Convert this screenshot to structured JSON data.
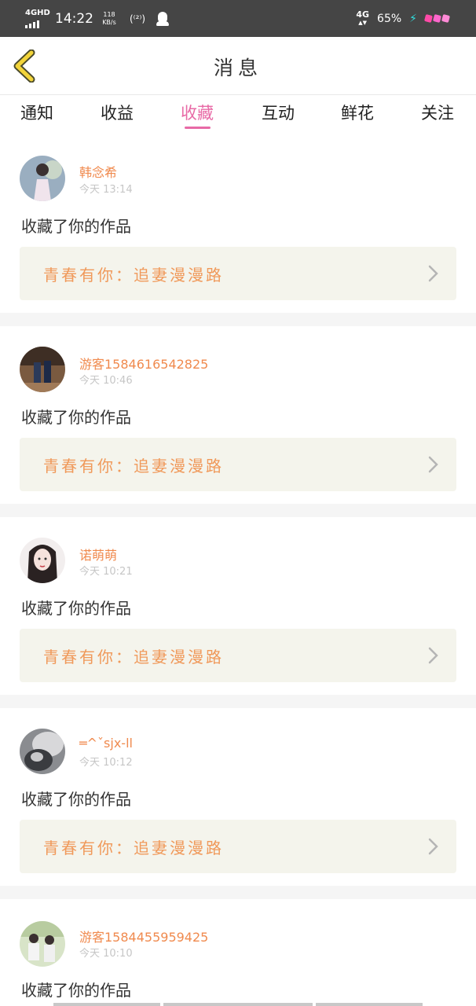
{
  "status_bar": {
    "network_type": "4GHD",
    "time": "14:22",
    "speed_value": "118",
    "speed_unit": "KB/s",
    "hotspot": "(⁽²⁾)",
    "cellular": "4G",
    "battery": "65%",
    "charging": "⚡"
  },
  "header": {
    "title": "消息"
  },
  "tabs": [
    {
      "label": "通知"
    },
    {
      "label": "收益"
    },
    {
      "label": "收藏"
    },
    {
      "label": "互动"
    },
    {
      "label": "鲜花"
    },
    {
      "label": "关注"
    }
  ],
  "active_tab": "收藏",
  "colors": {
    "accent": "#e86aa6",
    "name": "#f08a4e",
    "work_title": "#f0995a",
    "link_bg": "#f4f4ec"
  },
  "messages": [
    {
      "name": "韩念希",
      "time": "今天 13:14",
      "action": "收藏了你的作品",
      "work": "青春有你：追妻漫漫路"
    },
    {
      "name": "游客1584616542825",
      "time": "今天 10:46",
      "action": "收藏了你的作品",
      "work": "青春有你：追妻漫漫路"
    },
    {
      "name": "诺萌萌",
      "time": "今天 10:21",
      "action": "收藏了你的作品",
      "work": "青春有你：追妻漫漫路"
    },
    {
      "name": "═^ˇsjx-ll",
      "time": "今天 10:12",
      "action": "收藏了你的作品",
      "work": "青春有你：追妻漫漫路"
    },
    {
      "name": "游客1584455959425",
      "time": "今天 10:10",
      "action": "收藏了你的作品",
      "work": ""
    }
  ]
}
